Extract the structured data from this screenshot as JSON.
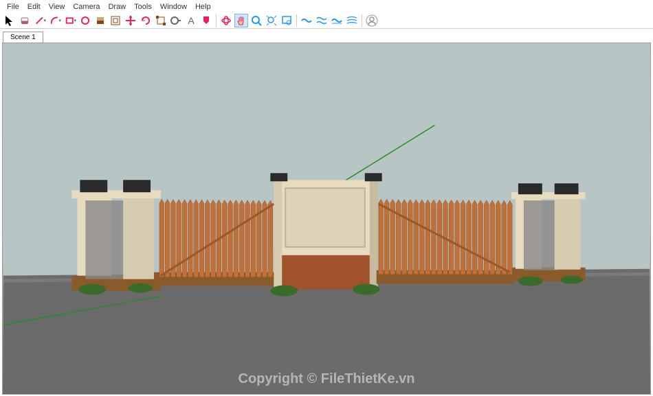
{
  "menubar": {
    "items": [
      "File",
      "Edit",
      "View",
      "Camera",
      "Draw",
      "Tools",
      "Window",
      "Help"
    ]
  },
  "tabs": {
    "items": [
      "Scene 1"
    ]
  },
  "watermark": {
    "file": "File",
    "thietke": "ThiếtKế",
    "vn": ".vn",
    "center": "Copyright © FileThietKe.vn"
  },
  "toolbar": {
    "groups": [
      [
        {
          "n": "select",
          "c": "#000"
        },
        {
          "n": "eraser",
          "c": "#b0577a"
        },
        {
          "n": "line",
          "c": "#e91e63",
          "dd": true
        },
        {
          "n": "arc",
          "c": "#e91e63",
          "dd": true
        },
        {
          "n": "rect",
          "c": "#e91e63",
          "dd": true
        },
        {
          "n": "circle",
          "c": "#e91e63"
        },
        {
          "n": "push",
          "c": "#8b4513"
        },
        {
          "n": "offset",
          "c": "#8b4513"
        },
        {
          "n": "move",
          "c": "#e91e63"
        },
        {
          "n": "rotate",
          "c": "#e91e63"
        },
        {
          "n": "scale",
          "c": "#8b4513"
        },
        {
          "n": "tape",
          "c": "#666"
        },
        {
          "n": "text",
          "c": "#666"
        },
        {
          "n": "paint",
          "c": "#e91e63"
        }
      ],
      [
        {
          "n": "orbit",
          "c": "#e91e63"
        },
        {
          "n": "pan",
          "c": "#e91e63",
          "active": true
        },
        {
          "n": "zoom",
          "c": "#2196f3"
        },
        {
          "n": "zoomext",
          "c": "#2196f3"
        },
        {
          "n": "zoomwin",
          "c": "#2196f3"
        }
      ],
      [
        {
          "n": "ext1",
          "c": "#2196f3"
        },
        {
          "n": "ext2",
          "c": "#2196f3"
        },
        {
          "n": "ext3",
          "c": "#2196f3"
        },
        {
          "n": "ext4",
          "c": "#2196f3"
        }
      ],
      [
        {
          "n": "user",
          "c": "#999"
        }
      ]
    ]
  }
}
